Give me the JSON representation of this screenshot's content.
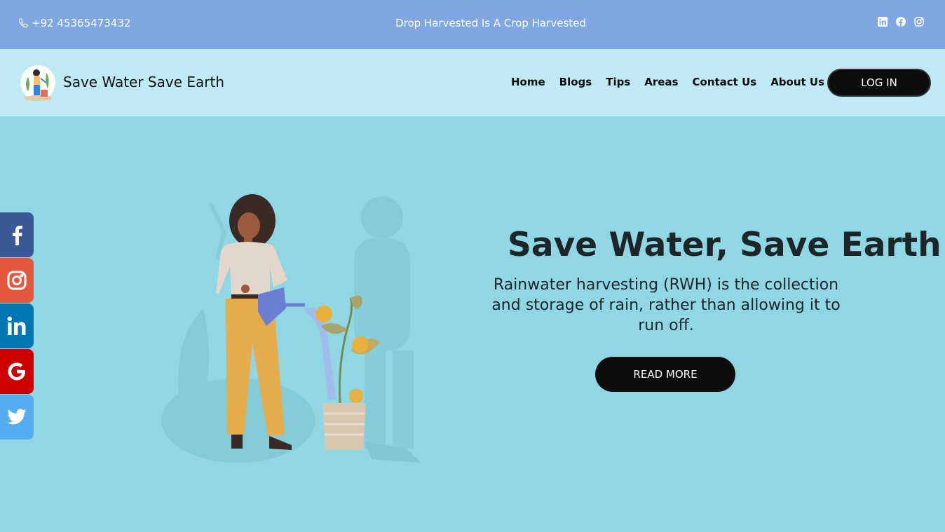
{
  "topbar": {
    "phone": "+92 45365473432",
    "tagline": "Drop Harvested Is A Crop Harvested",
    "social_icons": [
      "linkedin-icon",
      "facebook-icon",
      "instagram-icon"
    ]
  },
  "navbar": {
    "brand": "Save Water Save Earth",
    "links": [
      "Home",
      "Blogs",
      "Tips",
      "Areas",
      "Contact Us",
      "About Us"
    ],
    "login_label": "LOG IN"
  },
  "side_social": [
    {
      "icon": "facebook-icon",
      "color": "#3b5998"
    },
    {
      "icon": "instagram-icon",
      "color": "#e4583e"
    },
    {
      "icon": "linkedin-icon",
      "color": "#0077b5"
    },
    {
      "icon": "google-icon",
      "color": "#cc0000"
    },
    {
      "icon": "twitter-icon",
      "color": "#55acee"
    }
  ],
  "hero": {
    "title": "Save Water, Save Earth!",
    "text": "Rainwater harvesting (RWH) is the collection and storage of rain, rather than allowing it to run off.",
    "button_label": "READ MORE"
  },
  "colors": {
    "topbar_bg": "#7fa8e2",
    "navbar_bg": "#bfe9f5",
    "hero_bg": "#90d7e3",
    "button_bg": "#0d0d0d"
  }
}
